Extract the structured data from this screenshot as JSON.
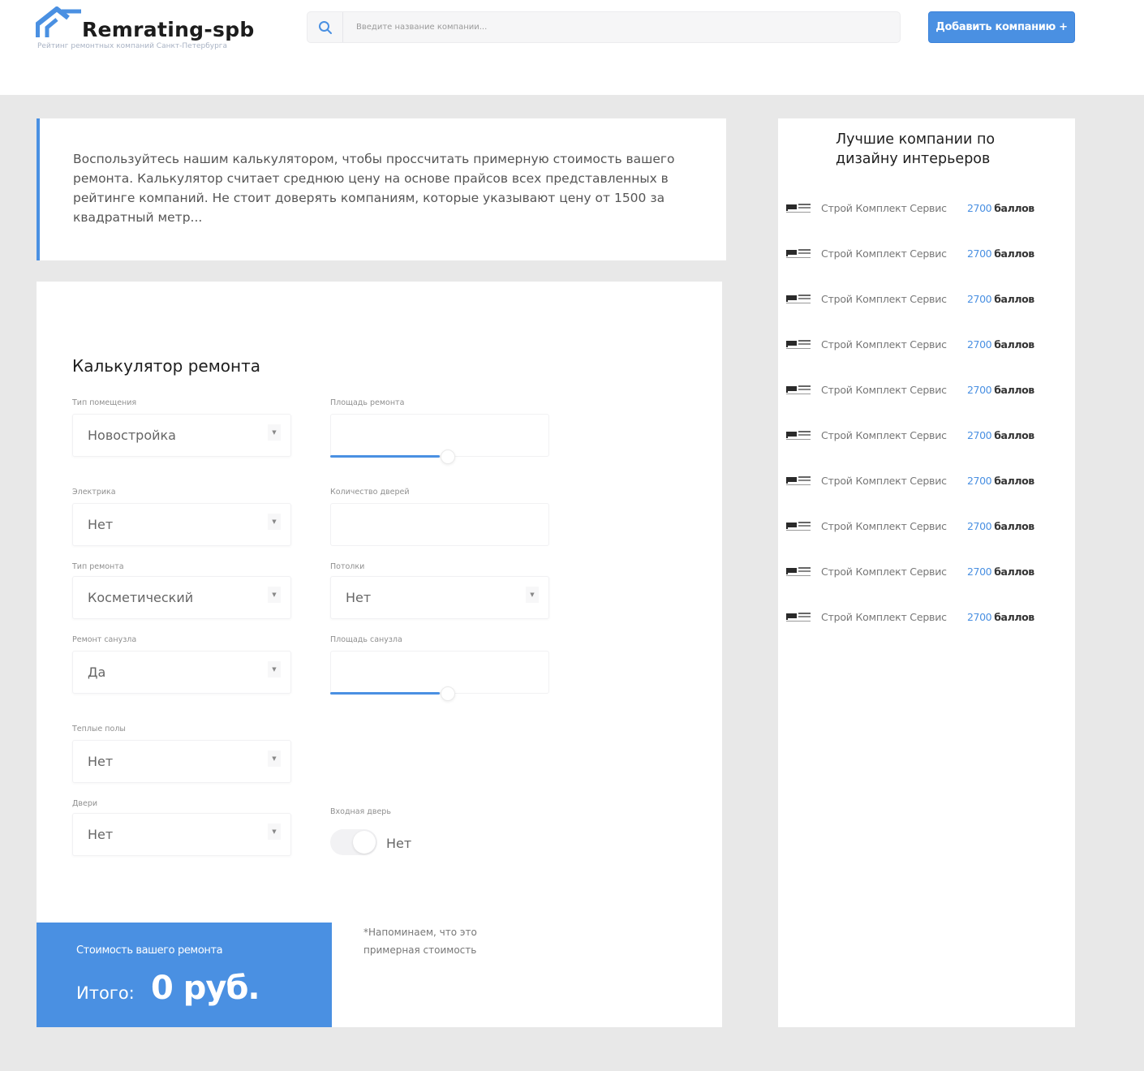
{
  "header": {
    "logo_title": "Remrating-spb",
    "logo_subtitle": "Рейтинг ремонтных компаний Санкт-Петербурга",
    "search_placeholder": "Введите название компании...",
    "add_button": "Добавить компанию +"
  },
  "intro": {
    "text": "Воспользуйтесь нашим калькулятором, чтобы проссчитать примерную стоимость вашего ремонта. Калькулятор считает среднюю цену на основе прайсов всех представленных в рейтинге компаний. Не стоит доверять компаниям, которые указывают цену от 1500 за квадратный метр..."
  },
  "calculator": {
    "title": "Калькулятор ремонта",
    "room_type": {
      "label": "Тип помещения",
      "value": "Новостройка"
    },
    "area": {
      "label": "Площадь ремонта",
      "fill_fraction": 0.5
    },
    "electrics": {
      "label": "Электрика",
      "value": "Нет"
    },
    "doors_count": {
      "label": "Количество дверей"
    },
    "repair_type": {
      "label": "Тип ремонта",
      "value": "Косметический"
    },
    "ceilings": {
      "label": "Потолки",
      "value": "Нет"
    },
    "bathroom_repair": {
      "label": "Ремонт санузла",
      "value": "Да"
    },
    "bathroom_area": {
      "label": "Площадь санузла",
      "fill_fraction": 0.5
    },
    "warm_floors": {
      "label": "Теплые полы",
      "value": "Нет"
    },
    "doors": {
      "label": "Двери",
      "value": "Нет"
    },
    "entrance_door": {
      "label": "Входная дверь",
      "value": "Нет"
    },
    "total": {
      "label": "Стоимость вашего ремонта",
      "prefix": "Итого:",
      "value": "0 руб."
    },
    "note": "*Напоминаем, что это примерная стоимость"
  },
  "sidebar": {
    "title": "Лучшие компании по дизайну интерьеров",
    "items": [
      {
        "name": "Строй Комплект Сервис",
        "score": "2700",
        "unit": "баллов"
      },
      {
        "name": "Строй Комплект Сервис",
        "score": "2700",
        "unit": "баллов"
      },
      {
        "name": "Строй Комплект Сервис",
        "score": "2700",
        "unit": "баллов"
      },
      {
        "name": "Строй Комплект Сервис",
        "score": "2700",
        "unit": "баллов"
      },
      {
        "name": "Строй Комплект Сервис",
        "score": "2700",
        "unit": "баллов"
      },
      {
        "name": "Строй Комплект Сервис",
        "score": "2700",
        "unit": "баллов"
      },
      {
        "name": "Строй Комплект Сервис",
        "score": "2700",
        "unit": "баллов"
      },
      {
        "name": "Строй Комплект Сервис",
        "score": "2700",
        "unit": "баллов"
      },
      {
        "name": "Строй Комплект Сервис",
        "score": "2700",
        "unit": "баллов"
      },
      {
        "name": "Строй Комплект Сервис",
        "score": "2700",
        "unit": "баллов"
      }
    ]
  },
  "colors": {
    "accent": "#4a90e2",
    "page_bg": "#e8e8e8",
    "card_bg": "#ffffff"
  }
}
